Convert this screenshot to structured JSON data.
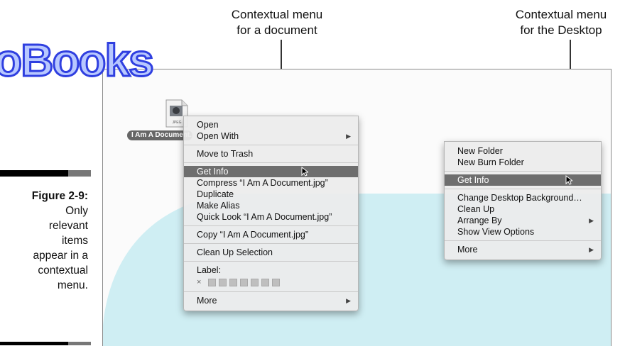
{
  "callouts": {
    "document": [
      "Contextual menu",
      "for a document"
    ],
    "desktop": [
      "Contextual menu",
      "for the Desktop"
    ]
  },
  "watermark": "oBooks",
  "caption": {
    "figure": "Figure 2-9:",
    "lines": [
      "Only",
      "relevant",
      "items",
      "appear in a",
      "contextual",
      "menu."
    ]
  },
  "file_icon": {
    "badge": "JPEG",
    "name": "I Am A Document.jpg"
  },
  "document_menu": {
    "open": "Open",
    "open_with": "Open With",
    "move_to_trash": "Move to Trash",
    "get_info": "Get Info",
    "compress": "Compress “I Am A Document.jpg”",
    "duplicate": "Duplicate",
    "make_alias": "Make Alias",
    "quick_look": "Quick Look “I Am A Document.jpg”",
    "copy": "Copy “I Am A Document.jpg”",
    "clean_up_selection": "Clean Up Selection",
    "label": "Label:",
    "label_clear": "×",
    "more": "More"
  },
  "desktop_menu": {
    "new_folder": "New Folder",
    "new_burn_folder": "New Burn Folder",
    "get_info": "Get Info",
    "change_background": "Change Desktop Background…",
    "clean_up": "Clean Up",
    "arrange_by": "Arrange By",
    "show_view_options": "Show View Options",
    "more": "More"
  },
  "icons": {
    "submenu": "submenu-arrow-icon",
    "cursor": "mouse-pointer-icon",
    "callout_arrow": "down-arrow-icon"
  },
  "colors": {
    "desktop_shape": "#cfeef3",
    "selection": "#6e6e6e",
    "watermark_fill": "#b8c8ff",
    "watermark_stroke": "#2f3fe0"
  }
}
